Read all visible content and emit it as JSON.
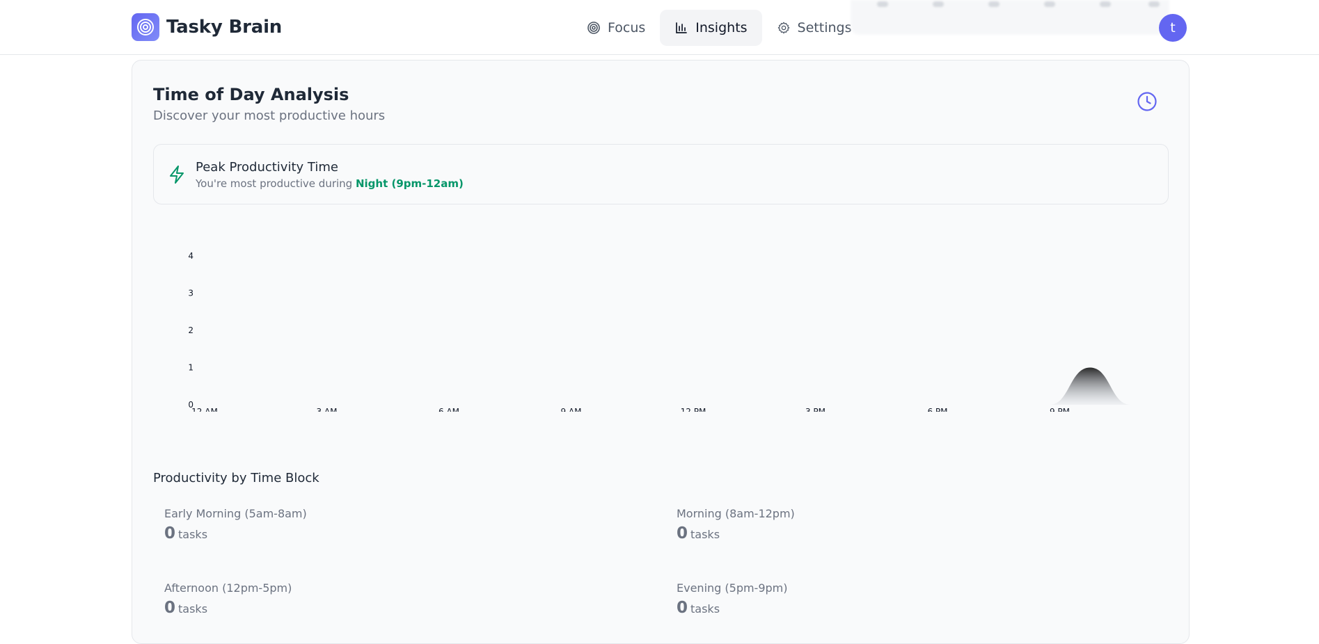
{
  "app": {
    "name": "Tasky Brain"
  },
  "nav": {
    "items": [
      {
        "label": "Focus",
        "icon": "target-icon",
        "active": false
      },
      {
        "label": "Insights",
        "icon": "bar-chart-icon",
        "active": true
      },
      {
        "label": "Settings",
        "icon": "gear-icon",
        "active": false
      }
    ]
  },
  "user": {
    "avatar_initial": "t"
  },
  "card": {
    "title": "Time of Day Analysis",
    "subtitle": "Discover your most productive hours"
  },
  "peak": {
    "title": "Peak Productivity Time",
    "desc_prefix": "You're most productive during ",
    "desc_highlight": "Night (9pm-12am)"
  },
  "chart_data": {
    "type": "area",
    "x_tick_labels": [
      "12 AM",
      "3 AM",
      "6 AM",
      "9 AM",
      "12 PM",
      "3 PM",
      "6 PM",
      "9 PM"
    ],
    "y_tick_labels": [
      "0",
      "1",
      "2",
      "3",
      "4"
    ],
    "ylim": [
      0,
      4
    ],
    "x": [
      0,
      1,
      2,
      3,
      4,
      5,
      6,
      7,
      8,
      9,
      10,
      11,
      12,
      13,
      14,
      15,
      16,
      17,
      18,
      19,
      20,
      21,
      22,
      23
    ],
    "values": [
      0,
      0,
      0,
      0,
      0,
      0,
      0,
      0,
      0,
      0,
      0,
      0,
      0,
      0,
      0,
      0,
      0,
      0,
      0,
      0,
      0,
      0,
      1,
      0
    ],
    "grid": false,
    "fill": "gradient-dark"
  },
  "blocks": {
    "title": "Productivity by Time Block",
    "unit": "tasks",
    "items": [
      {
        "label": "Early Morning (5am-8am)",
        "value": "0"
      },
      {
        "label": "Morning (8am-12pm)",
        "value": "0"
      },
      {
        "label": "Afternoon (12pm-5pm)",
        "value": "0"
      },
      {
        "label": "Evening (5pm-9pm)",
        "value": "0"
      }
    ]
  },
  "colors": {
    "accent": "#6366f1",
    "highlight": "#059669"
  }
}
